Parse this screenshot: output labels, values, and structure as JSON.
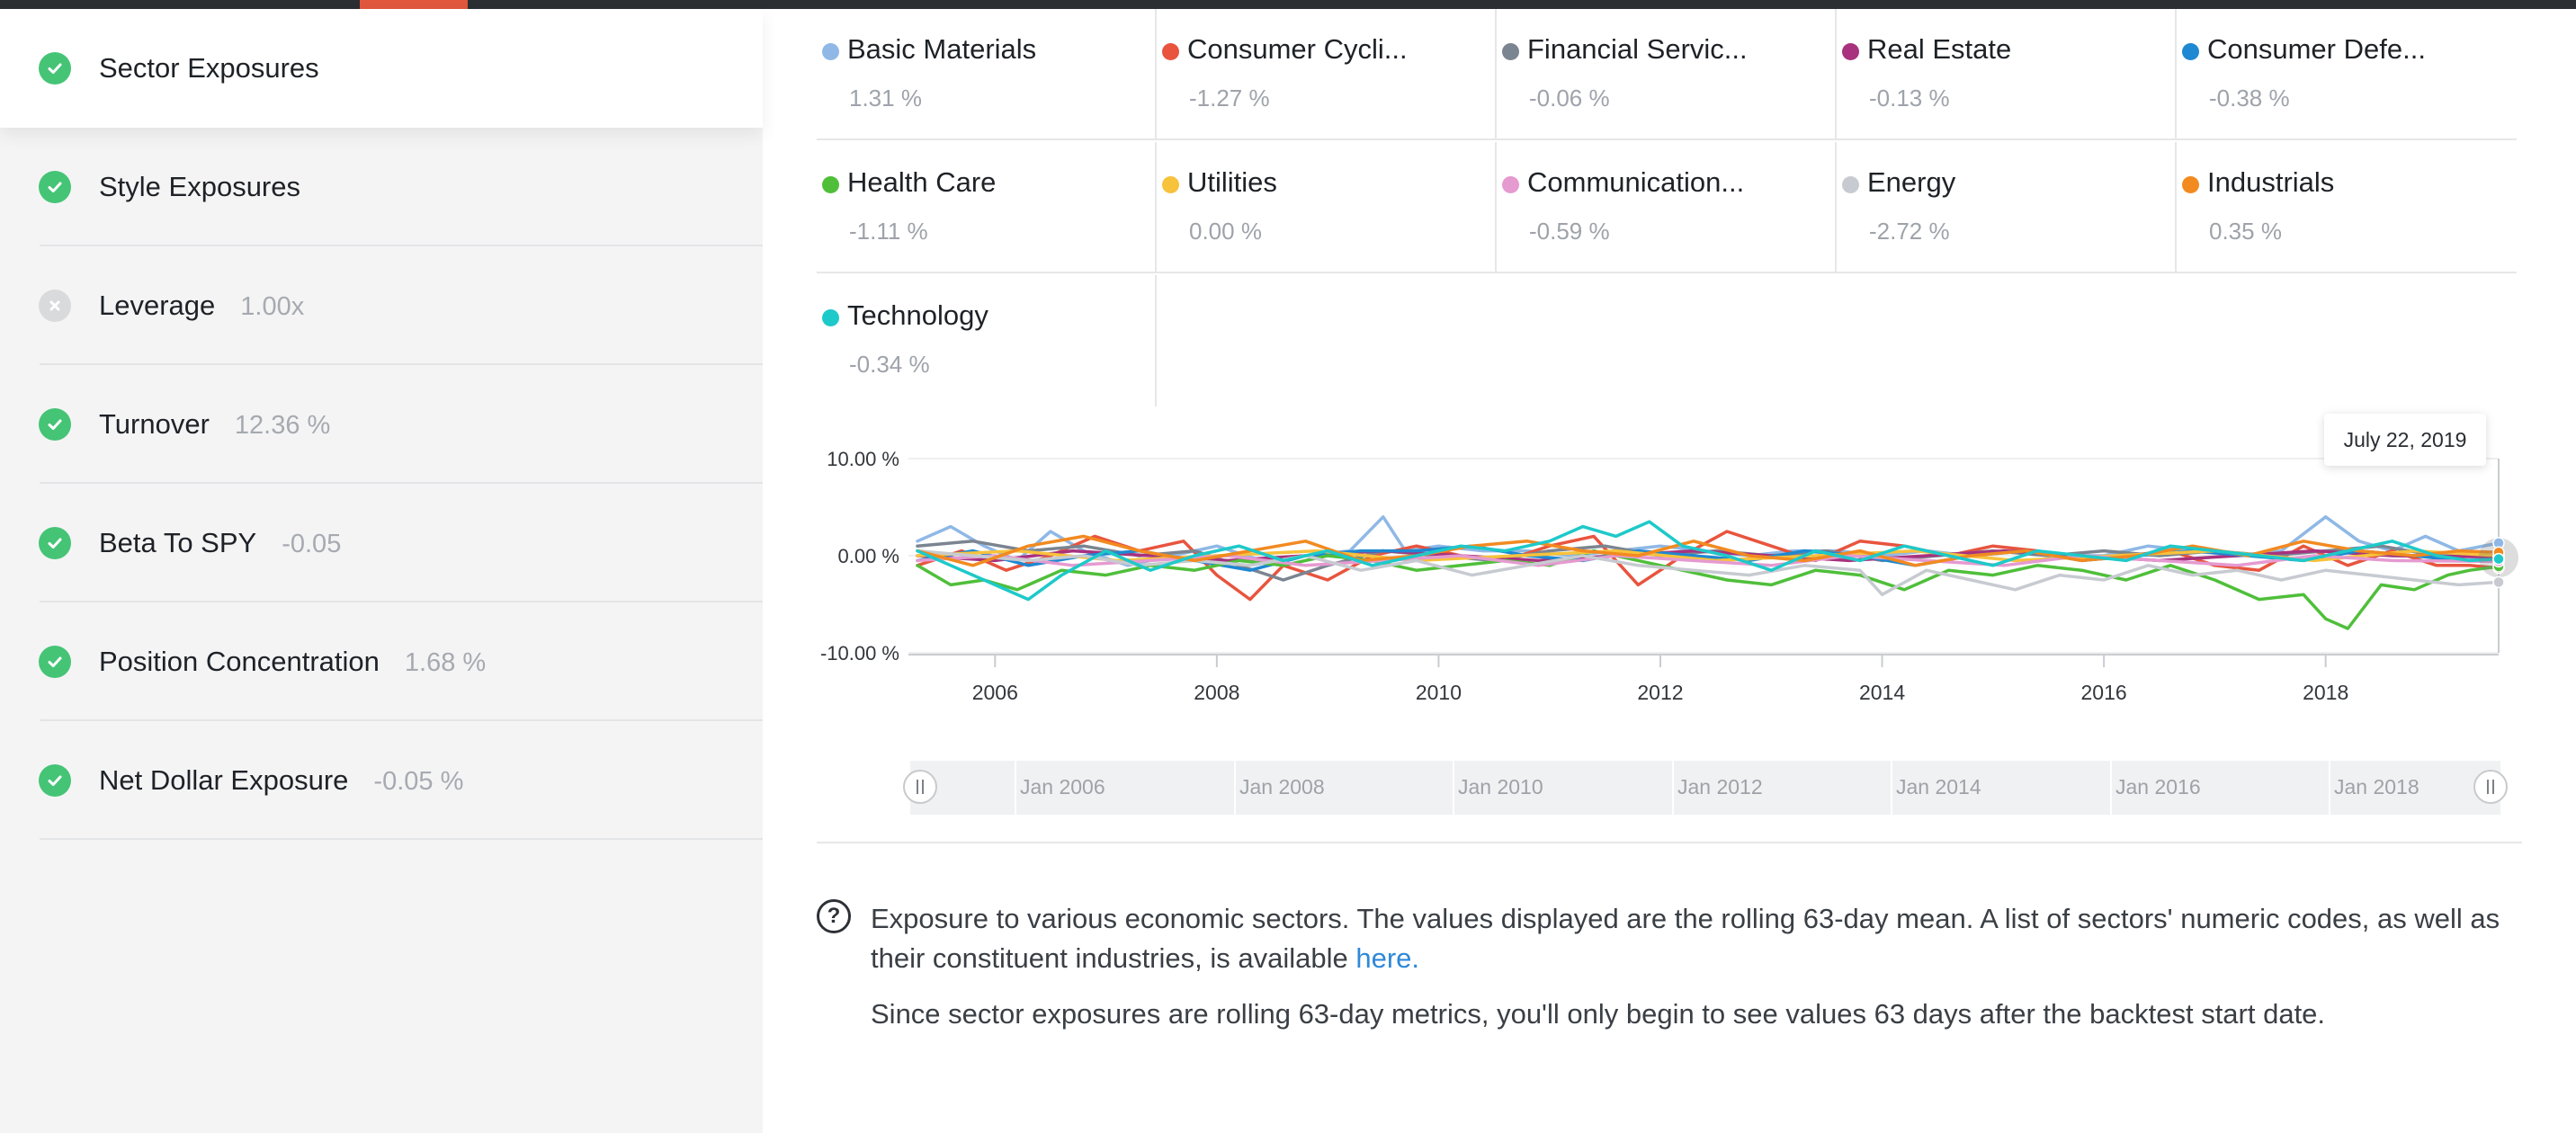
{
  "sidebar": {
    "items": [
      {
        "label": "Sector Exposures",
        "value": "",
        "status": "ok",
        "active": true
      },
      {
        "label": "Style Exposures",
        "value": "",
        "status": "ok",
        "active": false
      },
      {
        "label": "Leverage",
        "value": "1.00x",
        "status": "off",
        "active": false
      },
      {
        "label": "Turnover",
        "value": "12.36 %",
        "status": "ok",
        "active": false
      },
      {
        "label": "Beta To SPY",
        "value": "-0.05",
        "status": "ok",
        "active": false
      },
      {
        "label": "Position Concentration",
        "value": "1.68 %",
        "status": "ok",
        "active": false
      },
      {
        "label": "Net Dollar Exposure",
        "value": "-0.05 %",
        "status": "ok",
        "active": false
      }
    ]
  },
  "legend": [
    {
      "name": "Basic Materials",
      "value": "1.31 %",
      "color": "#8fb8e6"
    },
    {
      "name": "Consumer Cycli...",
      "value": "-1.27 %",
      "color": "#e8543e"
    },
    {
      "name": "Financial Servic...",
      "value": "-0.06 %",
      "color": "#7b8591"
    },
    {
      "name": "Real Estate",
      "value": "-0.13 %",
      "color": "#a8327e"
    },
    {
      "name": "Consumer Defe...",
      "value": "-0.38 %",
      "color": "#1e88d2"
    },
    {
      "name": "Health Care",
      "value": "-1.11 %",
      "color": "#4fbf3a"
    },
    {
      "name": "Utilities",
      "value": "0.00 %",
      "color": "#f7c23c"
    },
    {
      "name": "Communication...",
      "value": "-0.59 %",
      "color": "#e59ad0"
    },
    {
      "name": "Energy",
      "value": "-2.72 %",
      "color": "#c7cbd1"
    },
    {
      "name": "Industrials",
      "value": "0.35 %",
      "color": "#f28a20"
    },
    {
      "name": "Technology",
      "value": "-0.34 %",
      "color": "#1ec9c9"
    }
  ],
  "chart_data": {
    "type": "line",
    "y_ticks": [
      "10.00 %",
      "0.00 %",
      "-10.00 %"
    ],
    "ylim": [
      -10,
      10
    ],
    "x_ticks": [
      "2006",
      "2008",
      "2010",
      "2012",
      "2014",
      "2016",
      "2018"
    ],
    "xlim": [
      2005.3,
      2019.56
    ],
    "tooltip": "July 22, 2019",
    "series": [
      {
        "name": "Basic Materials",
        "color": "#8fb8e6",
        "x": [
          2005.3,
          2005.6,
          2005.9,
          2006.2,
          2006.5,
          2006.8,
          2007.2,
          2007.6,
          2008.0,
          2008.4,
          2008.8,
          2009.2,
          2009.5,
          2009.7,
          2010.0,
          2010.4,
          2010.8,
          2011.2,
          2011.6,
          2012.0,
          2012.4,
          2012.8,
          2013.2,
          2013.6,
          2014.0,
          2014.4,
          2014.8,
          2015.2,
          2015.6,
          2016.0,
          2016.4,
          2016.8,
          2017.2,
          2017.6,
          2018.0,
          2018.3,
          2018.6,
          2018.9,
          2019.2,
          2019.56
        ],
        "y": [
          1.5,
          3.0,
          1.0,
          -0.5,
          2.5,
          0.5,
          -1.0,
          0.0,
          1.0,
          -0.5,
          0.0,
          0.5,
          4.0,
          0.5,
          1.0,
          0.5,
          0.5,
          0.0,
          0.5,
          1.0,
          0.5,
          0.0,
          0.5,
          0.5,
          0.0,
          0.5,
          0.0,
          0.5,
          0.0,
          0.0,
          1.0,
          0.5,
          0.0,
          0.5,
          4.0,
          1.5,
          0.5,
          2.0,
          0.5,
          1.31
        ]
      },
      {
        "name": "Consumer Cycli...",
        "color": "#e8543e",
        "x": [
          2005.3,
          2005.7,
          2006.1,
          2006.5,
          2006.9,
          2007.3,
          2007.7,
          2008.0,
          2008.3,
          2008.6,
          2009.0,
          2009.4,
          2009.8,
          2010.2,
          2010.6,
          2011.0,
          2011.4,
          2011.8,
          2012.2,
          2012.6,
          2013.0,
          2013.4,
          2013.8,
          2014.2,
          2014.6,
          2015.0,
          2015.4,
          2015.8,
          2016.2,
          2016.6,
          2017.0,
          2017.4,
          2017.8,
          2018.2,
          2018.6,
          2019.0,
          2019.3,
          2019.56
        ],
        "y": [
          -1.0,
          0.5,
          -1.5,
          0.0,
          2.0,
          0.5,
          1.5,
          -2.0,
          -4.5,
          -1.0,
          -2.5,
          0.0,
          1.0,
          0.0,
          -0.5,
          1.0,
          2.0,
          -3.0,
          0.0,
          2.5,
          1.0,
          -0.5,
          1.5,
          1.0,
          0.0,
          1.0,
          0.5,
          -0.5,
          0.0,
          0.5,
          -1.0,
          -1.5,
          1.0,
          -1.0,
          0.5,
          -1.0,
          -1.0,
          -1.27
        ]
      },
      {
        "name": "Financial Servic...",
        "color": "#7b8591",
        "x": [
          2005.3,
          2005.8,
          2006.3,
          2006.8,
          2007.3,
          2007.8,
          2008.2,
          2008.6,
          2009.0,
          2009.5,
          2010.0,
          2010.5,
          2011.0,
          2011.5,
          2012.0,
          2012.5,
          2013.0,
          2013.5,
          2014.0,
          2014.5,
          2015.0,
          2015.5,
          2016.0,
          2016.5,
          2017.0,
          2017.5,
          2018.0,
          2018.5,
          2019.0,
          2019.56
        ],
        "y": [
          1.0,
          1.5,
          0.5,
          1.0,
          0.0,
          0.5,
          -1.0,
          -2.5,
          -1.0,
          0.5,
          0.0,
          -0.5,
          0.5,
          1.0,
          0.0,
          0.5,
          0.0,
          0.5,
          -0.5,
          0.0,
          0.5,
          0.0,
          0.5,
          0.0,
          0.5,
          0.0,
          0.5,
          1.0,
          0.0,
          -0.06
        ]
      },
      {
        "name": "Real Estate",
        "color": "#a8327e",
        "x": [
          2005.3,
          2006.0,
          2006.7,
          2007.4,
          2008.1,
          2008.8,
          2009.5,
          2010.2,
          2010.9,
          2011.6,
          2012.3,
          2013.0,
          2013.7,
          2014.4,
          2015.1,
          2015.8,
          2016.5,
          2017.2,
          2017.9,
          2018.6,
          2019.56
        ],
        "y": [
          0.0,
          -0.5,
          0.5,
          0.0,
          -0.5,
          0.0,
          0.5,
          0.0,
          -0.5,
          0.0,
          0.5,
          0.0,
          -0.5,
          0.0,
          0.5,
          0.0,
          -0.5,
          0.0,
          0.5,
          0.0,
          -0.13
        ]
      },
      {
        "name": "Consumer Defe...",
        "color": "#1e88d2",
        "x": [
          2005.3,
          2005.8,
          2006.3,
          2006.8,
          2007.3,
          2007.8,
          2008.3,
          2008.8,
          2009.3,
          2009.8,
          2010.3,
          2010.8,
          2011.3,
          2011.8,
          2012.3,
          2012.8,
          2013.3,
          2013.8,
          2014.3,
          2014.8,
          2015.3,
          2015.8,
          2016.3,
          2016.8,
          2017.3,
          2017.8,
          2018.3,
          2018.8,
          2019.2,
          2019.56
        ],
        "y": [
          -0.5,
          0.5,
          -1.0,
          0.0,
          0.5,
          -0.5,
          -1.5,
          0.0,
          0.5,
          0.5,
          1.0,
          0.0,
          -0.5,
          0.5,
          0.0,
          -0.5,
          0.5,
          0.0,
          -1.0,
          0.0,
          0.5,
          -0.5,
          0.0,
          0.5,
          0.0,
          -0.5,
          0.5,
          0.0,
          -0.5,
          -0.38
        ]
      },
      {
        "name": "Health Care",
        "color": "#4fbf3a",
        "x": [
          2005.3,
          2005.6,
          2005.9,
          2006.2,
          2006.6,
          2007.0,
          2007.4,
          2007.8,
          2008.2,
          2008.6,
          2009.0,
          2009.4,
          2009.8,
          2010.2,
          2010.6,
          2011.0,
          2011.4,
          2011.8,
          2012.2,
          2012.6,
          2013.0,
          2013.4,
          2013.8,
          2014.2,
          2014.6,
          2015.0,
          2015.4,
          2015.8,
          2016.2,
          2016.6,
          2017.0,
          2017.4,
          2017.8,
          2018.0,
          2018.2,
          2018.5,
          2018.8,
          2019.1,
          2019.3,
          2019.56
        ],
        "y": [
          -1.0,
          -3.0,
          -2.5,
          -3.5,
          -1.5,
          -2.0,
          -1.0,
          -1.5,
          -0.5,
          -1.0,
          0.0,
          -0.5,
          -1.5,
          -1.0,
          -0.5,
          -1.0,
          0.5,
          -0.5,
          -1.5,
          -2.5,
          -3.0,
          -1.5,
          -2.0,
          -3.5,
          -1.5,
          -2.0,
          -1.0,
          -1.5,
          -2.5,
          -1.0,
          -2.5,
          -4.5,
          -4.0,
          -6.5,
          -7.5,
          -3.0,
          -3.5,
          -2.0,
          -1.5,
          -1.11
        ]
      },
      {
        "name": "Utilities",
        "color": "#f7c23c",
        "x": [
          2005.3,
          2006.2,
          2007.1,
          2008.0,
          2008.9,
          2009.8,
          2010.7,
          2011.6,
          2012.5,
          2013.4,
          2014.3,
          2015.2,
          2016.1,
          2017.0,
          2017.9,
          2018.8,
          2019.56
        ],
        "y": [
          0.0,
          0.5,
          -0.5,
          0.0,
          0.5,
          -0.5,
          0.0,
          0.5,
          -0.5,
          0.0,
          0.5,
          -0.5,
          0.0,
          0.5,
          -0.5,
          0.5,
          0.0
        ]
      },
      {
        "name": "Communication...",
        "color": "#e59ad0",
        "x": [
          2005.3,
          2006.0,
          2006.7,
          2007.4,
          2008.1,
          2008.8,
          2009.5,
          2010.2,
          2010.9,
          2011.6,
          2012.3,
          2013.0,
          2013.7,
          2014.4,
          2015.1,
          2015.8,
          2016.5,
          2017.2,
          2017.9,
          2018.6,
          2019.56
        ],
        "y": [
          -0.5,
          0.0,
          -1.0,
          -0.5,
          0.0,
          -1.0,
          -0.5,
          0.0,
          -1.0,
          0.0,
          -0.5,
          -1.0,
          0.0,
          -0.5,
          -1.0,
          0.0,
          -0.5,
          -1.0,
          0.0,
          -0.5,
          -0.59
        ]
      },
      {
        "name": "Energy",
        "color": "#c7cbd1",
        "x": [
          2005.3,
          2005.8,
          2006.3,
          2006.8,
          2007.3,
          2007.8,
          2008.3,
          2008.8,
          2009.3,
          2009.8,
          2010.3,
          2010.8,
          2011.3,
          2011.8,
          2012.3,
          2012.8,
          2013.3,
          2013.8,
          2014.0,
          2014.4,
          2014.8,
          2015.2,
          2015.6,
          2016.0,
          2016.4,
          2016.8,
          2017.2,
          2017.6,
          2018.0,
          2018.4,
          2018.8,
          2019.2,
          2019.56
        ],
        "y": [
          0.5,
          0.0,
          -0.5,
          0.0,
          -1.0,
          -0.5,
          -1.0,
          0.0,
          -1.5,
          -0.5,
          -2.0,
          -1.0,
          0.0,
          -1.0,
          -1.5,
          -2.0,
          -1.0,
          -1.5,
          -4.0,
          -1.5,
          -2.5,
          -3.5,
          -2.0,
          -2.5,
          -1.0,
          -2.0,
          -1.5,
          -2.5,
          -1.5,
          -2.0,
          -2.5,
          -3.0,
          -2.72
        ]
      },
      {
        "name": "Industrials",
        "color": "#f28a20",
        "x": [
          2005.3,
          2005.8,
          2006.3,
          2006.8,
          2007.3,
          2007.8,
          2008.3,
          2008.8,
          2009.3,
          2009.8,
          2010.3,
          2010.8,
          2011.3,
          2011.8,
          2012.3,
          2012.8,
          2013.3,
          2013.8,
          2014.3,
          2014.8,
          2015.3,
          2015.8,
          2016.3,
          2016.8,
          2017.3,
          2017.8,
          2018.3,
          2018.8,
          2019.2,
          2019.56
        ],
        "y": [
          0.5,
          -1.0,
          1.0,
          2.0,
          0.5,
          -0.5,
          0.5,
          1.5,
          -0.5,
          0.0,
          1.0,
          1.5,
          0.5,
          0.0,
          1.5,
          0.0,
          -0.5,
          0.5,
          -1.0,
          0.0,
          0.5,
          -0.5,
          0.0,
          1.0,
          0.0,
          1.5,
          0.5,
          0.0,
          0.5,
          0.35
        ]
      },
      {
        "name": "Technology",
        "color": "#1ec9c9",
        "x": [
          2005.3,
          2005.6,
          2006.0,
          2006.3,
          2006.6,
          2007.0,
          2007.4,
          2007.8,
          2008.2,
          2008.6,
          2009.0,
          2009.4,
          2009.8,
          2010.2,
          2010.6,
          2011.0,
          2011.3,
          2011.6,
          2011.9,
          2012.2,
          2012.6,
          2013.0,
          2013.4,
          2013.8,
          2014.2,
          2014.6,
          2015.0,
          2015.4,
          2015.8,
          2016.2,
          2016.6,
          2017.0,
          2017.4,
          2017.8,
          2018.2,
          2018.6,
          2019.0,
          2019.3,
          2019.56
        ],
        "y": [
          0.5,
          -1.0,
          -3.0,
          -4.5,
          -2.0,
          0.5,
          -1.5,
          0.0,
          1.0,
          -0.5,
          0.5,
          -1.0,
          0.0,
          1.0,
          0.5,
          1.5,
          3.0,
          2.0,
          3.5,
          1.0,
          0.0,
          -1.5,
          0.5,
          -0.5,
          1.0,
          0.0,
          -1.0,
          0.5,
          0.0,
          -0.5,
          1.0,
          0.5,
          0.0,
          -0.5,
          0.5,
          1.5,
          0.0,
          -0.5,
          -0.34
        ]
      }
    ]
  },
  "navigator": {
    "labels": [
      "Jan 2006",
      "Jan 2008",
      "Jan 2010",
      "Jan 2012",
      "Jan 2014",
      "Jan 2016",
      "Jan 2018"
    ]
  },
  "help": {
    "text_pre": "Exposure to various economic sectors. The values displayed are the rolling 63-day mean. A list of sectors' numeric codes, as well as their constituent industries, is available ",
    "link": "here.",
    "text2": "Since sector exposures are rolling 63-day metrics, you'll only begin to see values 63 days after the backtest start date."
  }
}
